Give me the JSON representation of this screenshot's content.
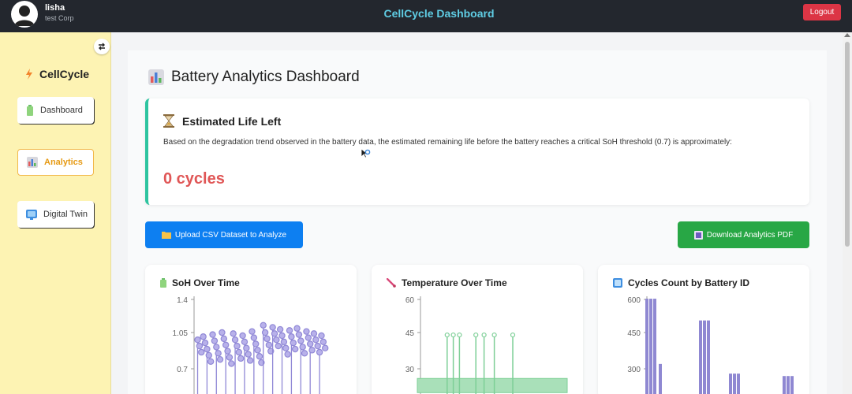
{
  "user": {
    "name": "lisha",
    "org": "test Corp"
  },
  "header": {
    "title": "CellCycle Dashboard",
    "logout_label": "Logout"
  },
  "sidebar": {
    "brand": "CellCycle",
    "items": [
      {
        "label": "Dashboard",
        "icon": "battery-icon"
      },
      {
        "label": "Analytics",
        "icon": "bar-chart-icon",
        "active": true
      },
      {
        "label": "Digital Twin",
        "icon": "monitor-icon"
      }
    ]
  },
  "page": {
    "title": "Battery Analytics Dashboard"
  },
  "life_card": {
    "title": "Estimated Life Left",
    "description": "Based on the degradation trend observed in the battery data, the estimated remaining life before the battery reaches a critical SoH threshold (0.7) is approximately:",
    "value": "0 cycles"
  },
  "actions": {
    "upload_label": "Upload CSV Dataset to Analyze",
    "download_label": "Download Analytics PDF"
  },
  "colors": {
    "accent": "#0d7ff1",
    "success": "#28a745",
    "danger": "#dc3545",
    "sidebar_bg": "#fdf3b3",
    "teal": "#2ec4a0"
  },
  "chart_data": [
    {
      "type": "scatter",
      "title": "SoH Over Time",
      "y_ticks": [
        "1.4",
        "1.05",
        "0.7"
      ],
      "ylim": [
        0.7,
        1.4
      ],
      "series_color": "#9088d6",
      "points": [
        [
          0.04,
          0.98
        ],
        [
          0.05,
          0.92
        ],
        [
          0.06,
          0.86
        ],
        [
          0.07,
          1.01
        ],
        [
          0.08,
          0.95
        ],
        [
          0.09,
          0.89
        ],
        [
          0.1,
          0.83
        ],
        [
          0.11,
          0.77
        ],
        [
          0.12,
          1.03
        ],
        [
          0.13,
          0.97
        ],
        [
          0.14,
          0.91
        ],
        [
          0.15,
          0.85
        ],
        [
          0.16,
          0.79
        ],
        [
          0.17,
          1.05
        ],
        [
          0.18,
          0.99
        ],
        [
          0.19,
          0.93
        ],
        [
          0.2,
          0.87
        ],
        [
          0.21,
          0.81
        ],
        [
          0.22,
          0.75
        ],
        [
          0.23,
          1.04
        ],
        [
          0.24,
          0.98
        ],
        [
          0.25,
          0.92
        ],
        [
          0.26,
          0.86
        ],
        [
          0.27,
          0.8
        ],
        [
          0.28,
          1.02
        ],
        [
          0.29,
          0.96
        ],
        [
          0.3,
          0.9
        ],
        [
          0.31,
          0.84
        ],
        [
          0.32,
          0.78
        ],
        [
          0.33,
          1.06
        ],
        [
          0.34,
          1.0
        ],
        [
          0.35,
          0.94
        ],
        [
          0.36,
          0.88
        ],
        [
          0.37,
          0.82
        ],
        [
          0.38,
          0.76
        ],
        [
          0.39,
          1.12
        ],
        [
          0.4,
          1.05
        ],
        [
          0.41,
          0.99
        ],
        [
          0.42,
          0.93
        ],
        [
          0.43,
          0.87
        ],
        [
          0.44,
          1.1
        ],
        [
          0.45,
          1.04
        ],
        [
          0.46,
          0.98
        ],
        [
          0.47,
          0.92
        ],
        [
          0.48,
          1.08
        ],
        [
          0.49,
          1.02
        ],
        [
          0.5,
          0.96
        ],
        [
          0.51,
          0.9
        ],
        [
          0.52,
          0.84
        ],
        [
          0.53,
          1.07
        ],
        [
          0.54,
          1.01
        ],
        [
          0.55,
          0.95
        ],
        [
          0.56,
          0.89
        ],
        [
          0.57,
          1.09
        ],
        [
          0.58,
          1.03
        ],
        [
          0.59,
          0.97
        ],
        [
          0.6,
          0.91
        ],
        [
          0.61,
          0.85
        ],
        [
          0.62,
          1.06
        ],
        [
          0.63,
          1.0
        ],
        [
          0.64,
          0.94
        ],
        [
          0.65,
          0.88
        ],
        [
          0.66,
          1.04
        ],
        [
          0.67,
          0.98
        ],
        [
          0.68,
          0.92
        ],
        [
          0.69,
          0.86
        ],
        [
          0.7,
          1.02
        ],
        [
          0.71,
          0.96
        ],
        [
          0.72,
          0.9
        ]
      ]
    },
    {
      "type": "line",
      "title": "Temperature Over Time",
      "y_ticks": [
        "60",
        "45",
        "30"
      ],
      "ylim": [
        30,
        60
      ],
      "series_color": "#7ecf97",
      "spikes": [
        0.13,
        0.16,
        0.19,
        0.27,
        0.31,
        0.36,
        0.45
      ]
    },
    {
      "type": "bar",
      "title": "Cycles Count by Battery ID",
      "y_ticks": [
        "600",
        "450",
        "300"
      ],
      "ylim": [
        300,
        600
      ],
      "series_color": "#8f88d2",
      "values": [
        590,
        590,
        590,
        320,
        500,
        500,
        500,
        280,
        280,
        280,
        270,
        270,
        270
      ]
    }
  ]
}
